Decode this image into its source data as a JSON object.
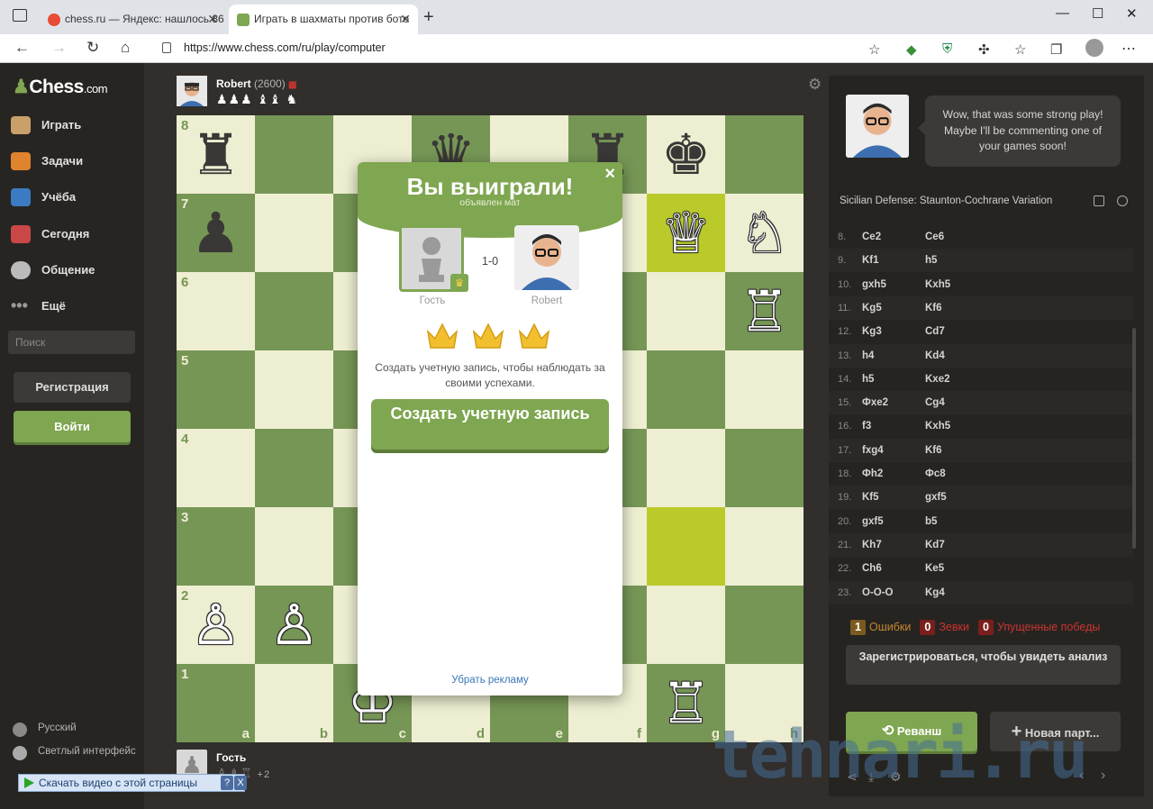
{
  "browser": {
    "tabs": [
      {
        "label": "chess.ru — Яндекс: нашлось 86",
        "active": false
      },
      {
        "label": "Играть в шахматы против бото",
        "active": true
      }
    ],
    "url": "https://www.chess.com/ru/play/computer"
  },
  "sidebar": {
    "logo": "Chess",
    "logo_suffix": ".com",
    "items": [
      {
        "label": "Играть",
        "icon": "play-icon"
      },
      {
        "label": "Задачи",
        "icon": "puzzle-icon"
      },
      {
        "label": "Учёба",
        "icon": "learn-icon"
      },
      {
        "label": "Сегодня",
        "icon": "news-icon"
      },
      {
        "label": "Общение",
        "icon": "social-icon"
      },
      {
        "label": "Ещё",
        "icon": "more-icon"
      }
    ],
    "search_placeholder": "Поиск",
    "register_label": "Регистрация",
    "login_label": "Войти",
    "footer": [
      "Русский",
      "Светлый интерфейс"
    ]
  },
  "players": {
    "top": {
      "name": "Robert",
      "rating": "(2600)",
      "captured": "♟♟♟ ♝♝ ♞"
    },
    "bottom": {
      "name": "Гость",
      "captured": "♙♗♖",
      "extra": "+2"
    }
  },
  "board": {
    "files": [
      "a",
      "b",
      "c",
      "d",
      "e",
      "f",
      "g",
      "h"
    ],
    "ranks": [
      "8",
      "7",
      "6",
      "5",
      "4",
      "3",
      "2",
      "1"
    ],
    "highlights": [
      "g7",
      "g3"
    ],
    "pieces": [
      {
        "sq": "a8",
        "glyph": "♜",
        "color": "b"
      },
      {
        "sq": "d8",
        "glyph": "♛",
        "color": "b"
      },
      {
        "sq": "f8",
        "glyph": "♜",
        "color": "b"
      },
      {
        "sq": "g8",
        "glyph": "♚",
        "color": "b"
      },
      {
        "sq": "a7",
        "glyph": "♟",
        "color": "b"
      },
      {
        "sq": "g7",
        "glyph": "♕",
        "color": "w"
      },
      {
        "sq": "h7",
        "glyph": "♘",
        "color": "w"
      },
      {
        "sq": "h6",
        "glyph": "♖",
        "color": "w"
      },
      {
        "sq": "a2",
        "glyph": "♙",
        "color": "w"
      },
      {
        "sq": "b2",
        "glyph": "♙",
        "color": "w"
      },
      {
        "sq": "c1",
        "glyph": "♔",
        "color": "w"
      },
      {
        "sq": "g1",
        "glyph": "♖",
        "color": "w"
      }
    ]
  },
  "modal": {
    "title": "Вы выиграли!",
    "subtitle": "объявлен мат",
    "score": "1-0",
    "left_name": "Гость",
    "right_name": "Robert",
    "text": "Создать учетную запись, чтобы наблюдать за своими успехами.",
    "cta": "Создать учетную запись",
    "ads_link": "Убрать рекламу"
  },
  "panel": {
    "bot_message": "Wow, that was some strong play! Maybe I'll be commenting one of your games soon!",
    "opening": "Sicilian Defense: Staunton-Cochrane Variation",
    "moves": [
      {
        "n": "8.",
        "w": "Ce2",
        "b": "Ce6"
      },
      {
        "n": "9.",
        "w": "Kf1",
        "b": "h5"
      },
      {
        "n": "10.",
        "w": "gxh5",
        "b": "Kxh5"
      },
      {
        "n": "11.",
        "w": "Kg5",
        "b": "Kf6"
      },
      {
        "n": "12.",
        "w": "Kg3",
        "b": "Cd7"
      },
      {
        "n": "13.",
        "w": "h4",
        "b": "Kd4"
      },
      {
        "n": "14.",
        "w": "h5",
        "b": "Kxe2"
      },
      {
        "n": "15.",
        "w": "Фxe2",
        "b": "Cg4"
      },
      {
        "n": "16.",
        "w": "f3",
        "b": "Kxh5"
      },
      {
        "n": "17.",
        "w": "fxg4",
        "b": "Kf6"
      },
      {
        "n": "18.",
        "w": "Фh2",
        "b": "Фc8"
      },
      {
        "n": "19.",
        "w": "Kf5",
        "b": "gxf5"
      },
      {
        "n": "20.",
        "w": "gxf5",
        "b": "b5"
      },
      {
        "n": "21.",
        "w": "Kh7",
        "b": "Kd7"
      },
      {
        "n": "22.",
        "w": "Ch6",
        "b": "Ke5"
      },
      {
        "n": "23.",
        "w": "O-O-O",
        "b": "Kg4"
      }
    ],
    "stats": [
      {
        "count": "1",
        "label": "Ошибки",
        "color": "#c5862f",
        "bg": "#7a5a1f"
      },
      {
        "count": "0",
        "label": "Зевки",
        "color": "#ca3431",
        "bg": "#7a1f1d"
      },
      {
        "count": "0",
        "label": "Упущенные победы",
        "color": "#ca3431",
        "bg": "#7a1f1d"
      }
    ],
    "analysis_label": "Зарегистрироваться, чтобы увидеть анализ",
    "rematch_label": "Реванш",
    "newgame_label": "Новая парт..."
  },
  "overlays": {
    "watermark": "tehnari.ru",
    "download_bar": "Скачать видео с этой страницы",
    "download_help": "?",
    "download_close": "X"
  }
}
